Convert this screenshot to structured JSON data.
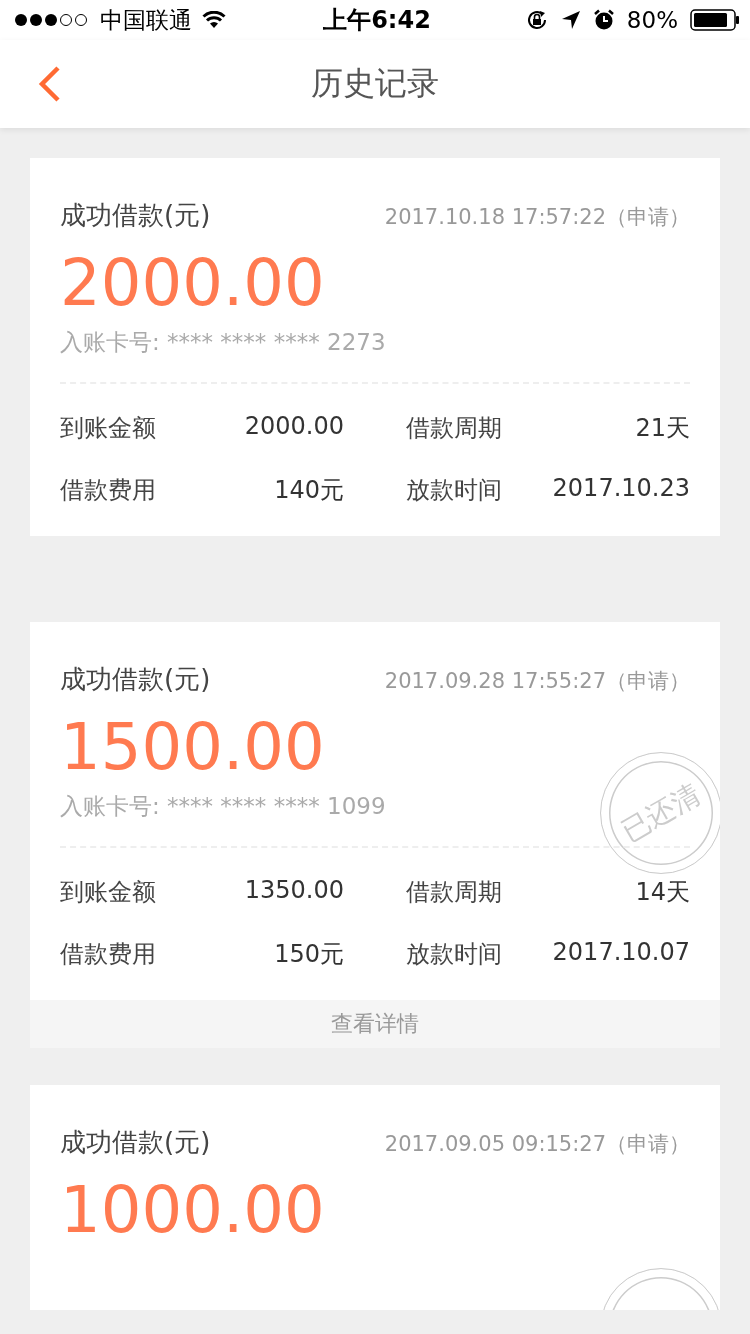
{
  "status_bar": {
    "carrier": "中国联通",
    "time": "上午6:42",
    "battery": "80%"
  },
  "nav": {
    "title": "历史记录"
  },
  "cards": [
    {
      "title": "成功借款(元)",
      "time": "2017.10.18 17:57:22（申请）",
      "amount": "2000.00",
      "card_number": "入账卡号: **** **** **** 2273",
      "details": [
        {
          "label": "到账金额",
          "value": "2000.00"
        },
        {
          "label": "借款周期",
          "value": "21天"
        },
        {
          "label": "借款费用",
          "value": "140元"
        },
        {
          "label": "放款时间",
          "value": "2017.10.23"
        }
      ],
      "stamp": false
    },
    {
      "title": "成功借款(元)",
      "time": "2017.09.28 17:55:27（申请）",
      "amount": "1500.00",
      "card_number": "入账卡号: **** **** **** 1099",
      "details": [
        {
          "label": "到账金额",
          "value": "1350.00"
        },
        {
          "label": "借款周期",
          "value": "14天"
        },
        {
          "label": "借款费用",
          "value": "150元"
        },
        {
          "label": "放款时间",
          "value": "2017.10.07"
        }
      ],
      "stamp": true,
      "stamp_text": "已还清",
      "detail_link": "查看详情"
    },
    {
      "title": "成功借款(元)",
      "time": "2017.09.05 09:15:27（申请）",
      "amount": "1000.00",
      "stamp": true
    }
  ]
}
